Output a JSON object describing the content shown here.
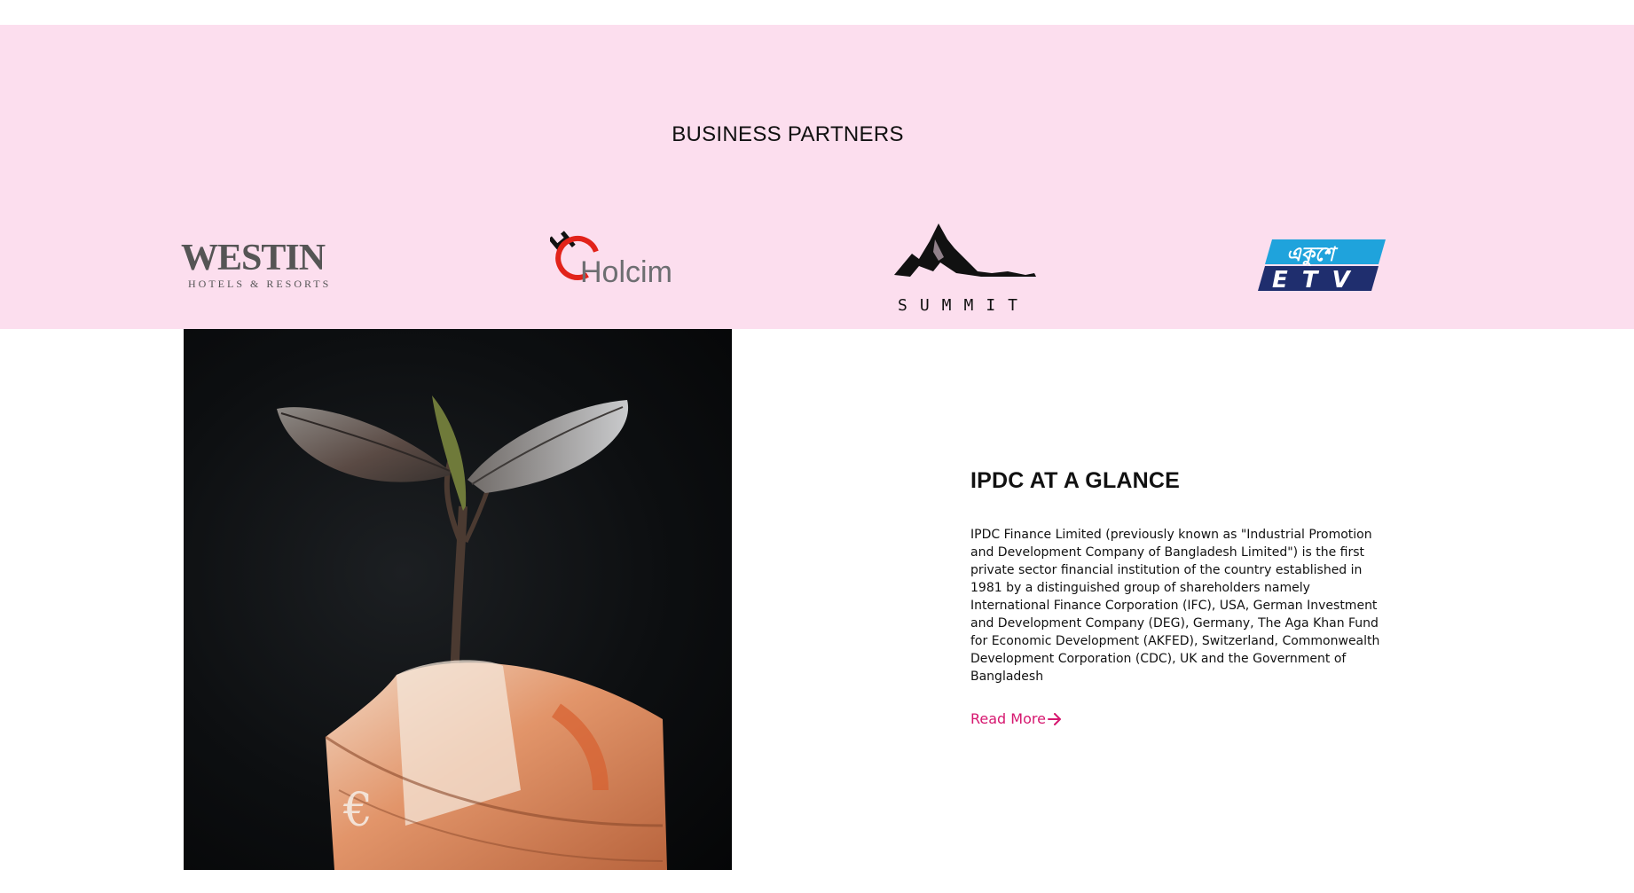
{
  "partners": {
    "title": "BUSINESS PARTNERS",
    "logos": [
      {
        "name": "Westin",
        "wordmark": "WESTIN",
        "tagline": "HOTELS & RESORTS",
        "color": "#555555"
      },
      {
        "name": "Holcim",
        "wordmark": "Holcim",
        "accent": "#e2231a",
        "color": "#6d6e71"
      },
      {
        "name": "Summit",
        "wordmark": "SUMMIT",
        "color": "#111111"
      },
      {
        "name": "ETV",
        "wordmark": "ETV",
        "bangla": "একুশে",
        "color_top": "#1fa3dc",
        "color_bottom": "#1f2e6e"
      }
    ],
    "background": "#fcdeee"
  },
  "glance": {
    "title": "IPDC AT A GLANCE",
    "body": "IPDC Finance Limited (previously known as \"Industrial Promotion and Development Company of Bangladesh Limited\") is the first private sector financial institution of the country established in 1981 by a distinguished group of shareholders namely International Finance Corporation (IFC), USA, German Investment and Development Company (DEG), Germany, The Aga Khan Fund for Economic Development (AKFED), Switzerland, Commonwealth Development Corporation (CDC), UK and the Government of Bangladesh",
    "read_more": "Read More",
    "read_more_icon": "arrow-right-icon",
    "accent": "#d6176f",
    "photo": "seedling growing from rolled euro banknote"
  }
}
